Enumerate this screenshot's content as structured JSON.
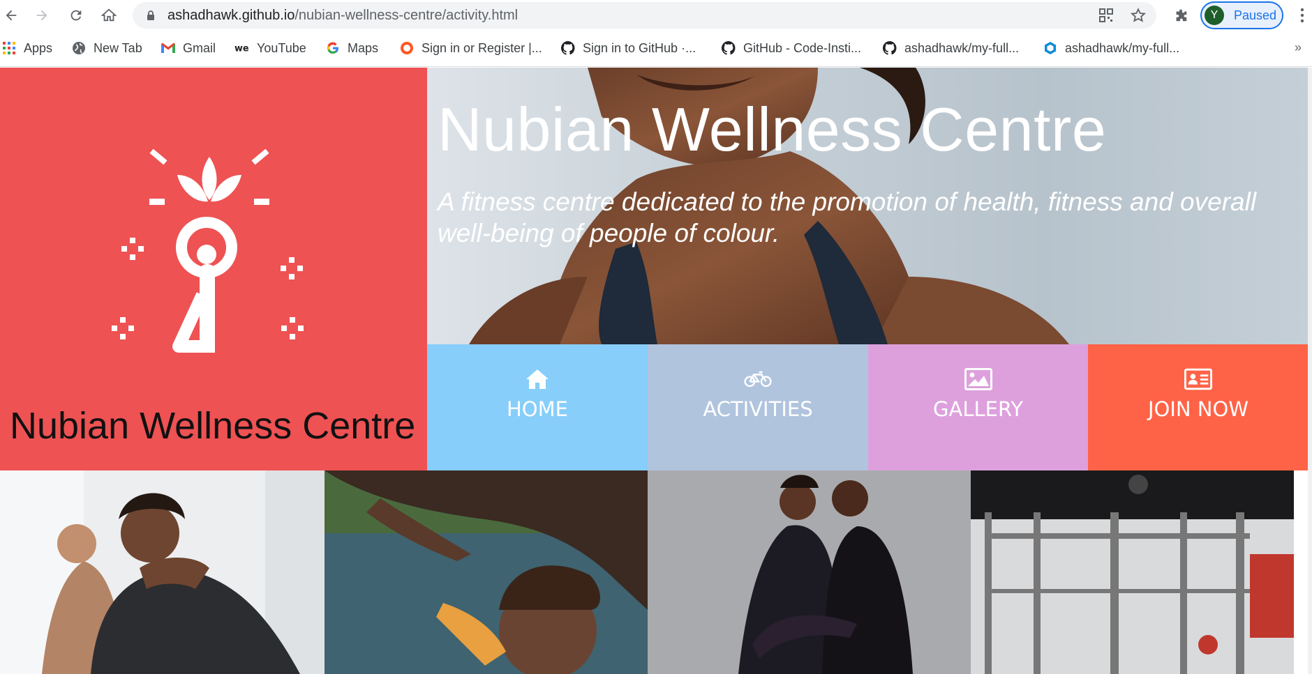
{
  "browser": {
    "url_host": "ashadhawk.github.io",
    "url_path": "/nubian-wellness-centre/activity.html",
    "profile_initial": "Y",
    "profile_status": "Paused",
    "bookmarks": [
      {
        "label": "Apps",
        "icon": "apps-grid-icon"
      },
      {
        "label": "New Tab",
        "icon": "globe-icon"
      },
      {
        "label": "Gmail",
        "icon": "gmail-icon"
      },
      {
        "label": "YouTube",
        "icon": "we-icon"
      },
      {
        "label": "Maps",
        "icon": "google-icon"
      },
      {
        "label": "Sign in or Register |...",
        "icon": "ring-icon"
      },
      {
        "label": "Sign in to GitHub ·...",
        "icon": "github-icon"
      },
      {
        "label": "GitHub - Code-Insti...",
        "icon": "github-icon"
      },
      {
        "label": "ashadhawk/my-full...",
        "icon": "github-icon"
      },
      {
        "label": "ashadhawk/my-full...",
        "icon": "cube-icon"
      }
    ],
    "more_label": "»"
  },
  "site": {
    "brand": "Nubian Wellness Centre",
    "hero_title": "Nubian Wellness Centre",
    "hero_subtitle": "A fitness centre dedicated to the promotion of health, fitness and overall well-being of people of colour.",
    "nav": [
      {
        "label": "HOME",
        "icon": "home-icon",
        "color": "#87cefa"
      },
      {
        "label": "ACTIVITIES",
        "icon": "bicycle-icon",
        "color": "#b0c4de"
      },
      {
        "label": "GALLERY",
        "icon": "image-icon",
        "color": "#dda0dd"
      },
      {
        "label": "JOIN NOW",
        "icon": "id-card-icon",
        "color": "#ff6347"
      }
    ],
    "photos": [
      "yoga-photo",
      "swimming-photo",
      "dance-photo",
      "gym-photo"
    ],
    "colors": {
      "logo_panel": "#ee5253",
      "brand_text": "#111111"
    }
  }
}
